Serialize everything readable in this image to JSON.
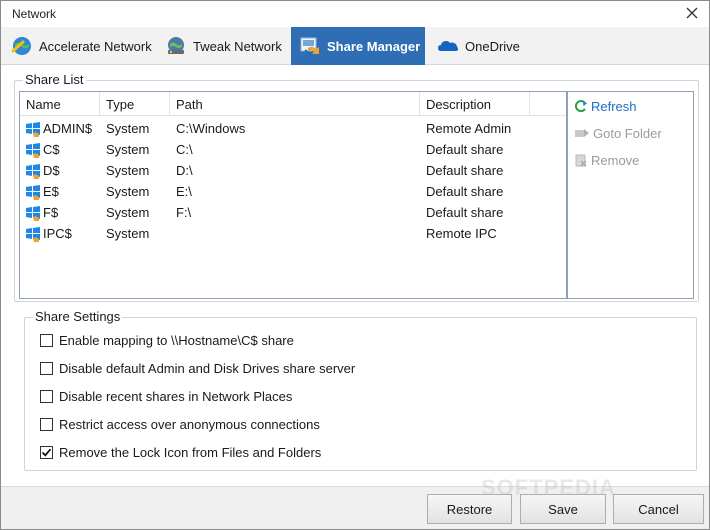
{
  "window": {
    "title": "Network"
  },
  "tabs": [
    {
      "label": "Accelerate Network",
      "icon": "globe-speed-icon",
      "active": false
    },
    {
      "label": "Tweak Network",
      "icon": "network-tweak-icon",
      "active": false
    },
    {
      "label": "Share Manager",
      "icon": "share-manager-icon",
      "active": true
    },
    {
      "label": "OneDrive",
      "icon": "cloud-icon",
      "active": false
    }
  ],
  "share_list": {
    "legend": "Share List",
    "columns": [
      "Name",
      "Type",
      "Path",
      "Description"
    ],
    "rows": [
      {
        "name": "ADMIN$",
        "type": "System",
        "path": "C:\\Windows",
        "description": "Remote Admin"
      },
      {
        "name": "C$",
        "type": "System",
        "path": "C:\\",
        "description": "Default share"
      },
      {
        "name": "D$",
        "type": "System",
        "path": "D:\\",
        "description": "Default share"
      },
      {
        "name": "E$",
        "type": "System",
        "path": "E:\\",
        "description": "Default share"
      },
      {
        "name": "F$",
        "type": "System",
        "path": "F:\\",
        "description": "Default share"
      },
      {
        "name": "IPC$",
        "type": "System",
        "path": "",
        "description": "Remote IPC"
      }
    ]
  },
  "actions": {
    "refresh": "Refresh",
    "goto_folder": "Goto Folder",
    "remove": "Remove"
  },
  "share_settings": {
    "legend": "Share Settings",
    "options": [
      {
        "label": "Enable mapping to \\\\Hostname\\C$ share",
        "checked": false
      },
      {
        "label": "Disable default Admin and Disk Drives share server",
        "checked": false
      },
      {
        "label": "Disable recent shares in Network Places",
        "checked": false
      },
      {
        "label": "Restrict access over anonymous connections",
        "checked": false
      },
      {
        "label": "Remove the Lock Icon from Files and Folders",
        "checked": true
      }
    ]
  },
  "footer": {
    "restore": "Restore",
    "save": "Save",
    "cancel": "Cancel"
  },
  "watermark": "SOFTPEDIA",
  "colors": {
    "accent": "#2f6db5",
    "link": "#1f6fc5",
    "disabled": "#9a9a9a"
  }
}
